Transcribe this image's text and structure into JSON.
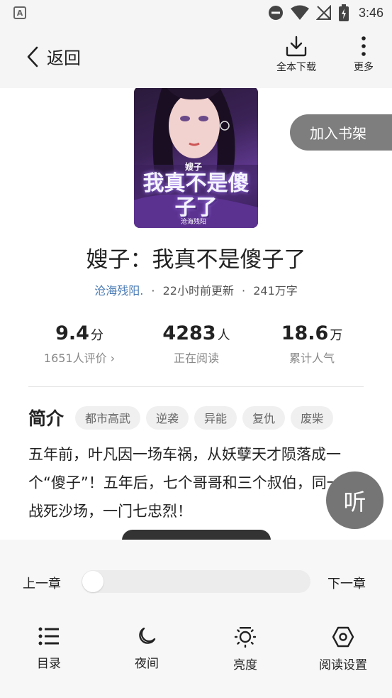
{
  "status_bar": {
    "time": "3:46",
    "app_badge": "A"
  },
  "nav": {
    "back_label": "返回",
    "download_label": "全本下载",
    "more_label": "更多"
  },
  "book": {
    "add_shelf_label": "加入书架",
    "title": "嫂子：我真不是傻子了",
    "author": "沧海残阳.",
    "updated": "22小时前更新",
    "word_count": "241万字",
    "cover_title": "我真不是傻子了",
    "cover_prefix": "嫂子",
    "cover_author": "沧海残阳"
  },
  "stats": [
    {
      "value": "9.4",
      "unit": "分",
      "label": "1651人评价 ›"
    },
    {
      "value": "4283",
      "unit": "人",
      "label": "正在阅读"
    },
    {
      "value": "18.6",
      "unit": "万",
      "label": "累计人气"
    }
  ],
  "intro": {
    "heading": "简介",
    "tags": [
      "都市高武",
      "逆袭",
      "异能",
      "复仇",
      "废柴"
    ],
    "text": "五年前，叶凡因一场车祸，从妖孽天才陨落成一个“傻子”！五年后，七个哥哥和三个叔伯，同一天战死沙场，一门七忠烈！"
  },
  "listen_label": "听",
  "reader": {
    "prev_chapter": "上一章",
    "next_chapter": "下一章",
    "progress": 0
  },
  "toolbar": [
    {
      "label": "目录",
      "icon": "list-icon"
    },
    {
      "label": "夜间",
      "icon": "moon-icon"
    },
    {
      "label": "亮度",
      "icon": "brightness-icon"
    },
    {
      "label": "阅读设置",
      "icon": "settings-hexagon-icon"
    }
  ]
}
